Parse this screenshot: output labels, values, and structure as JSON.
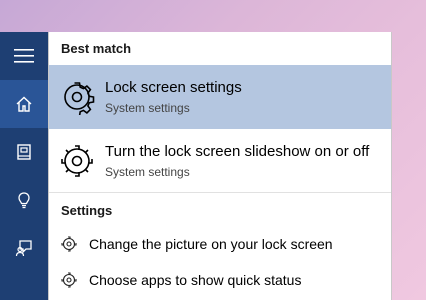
{
  "sidebar": {
    "items": [
      {
        "icon": "hamburger-menu-icon"
      },
      {
        "icon": "home-icon",
        "active": true
      },
      {
        "icon": "notebook-icon"
      },
      {
        "icon": "lightbulb-icon"
      },
      {
        "icon": "feedback-icon"
      }
    ],
    "bg_color": "#1e3f73",
    "active_color": "#2a5597"
  },
  "best_match": {
    "heading": "Best match",
    "results": [
      {
        "title": "Lock screen settings",
        "subtitle": "System settings",
        "icon": "gear-icon",
        "selected": true
      },
      {
        "title": "Turn the lock screen slideshow on or off",
        "subtitle": "System settings",
        "icon": "gear-icon",
        "selected": false
      }
    ]
  },
  "settings": {
    "heading": "Settings",
    "items": [
      {
        "label": "Change the picture on your lock screen",
        "icon": "gear-icon"
      },
      {
        "label": "Choose apps to show quick status",
        "icon": "gear-icon"
      }
    ]
  },
  "colors": {
    "selected_row": "#b4c6e0"
  }
}
